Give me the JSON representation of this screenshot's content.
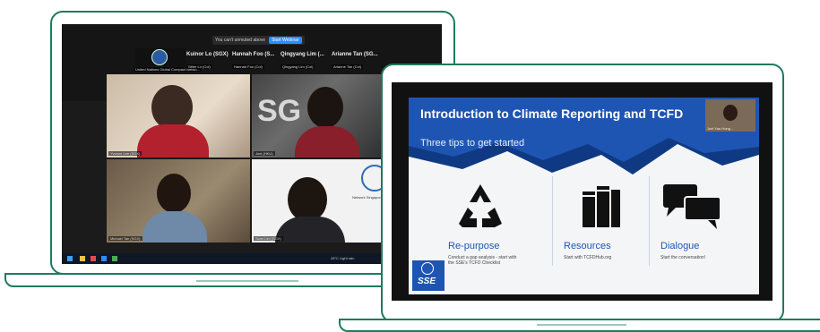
{
  "left_laptop": {
    "zoom_banner": {
      "text": "You can't unmuted above",
      "button": "Start Webinar"
    },
    "top_participants": [
      {
        "name": "Kuinor Lo (SGX)",
        "sub": "Sitter Lo (Col)"
      },
      {
        "name": "Hannah Foo (S...",
        "sub": "Hannah Foo (Col)"
      },
      {
        "name": "Qingyang Lim (...",
        "sub": "Qingyang Lim (Col)"
      },
      {
        "name": "Arianne Tan (SG...",
        "sub": "Arianne Tan (Col)"
      }
    ],
    "first_tile_caption": "United Nations Global Compact Netwo...",
    "video_tiles": [
      {
        "name": "Yvonne Lee (SGX)"
      },
      {
        "name": "Joel (HKU)"
      },
      {
        "name": "Michael Tan (SGX)"
      },
      {
        "name": "Sumi Lim (SGX)"
      }
    ],
    "logo_caption": "Network Singapore",
    "taskbar": {
      "temp": "28°C",
      "weather": "Light rain"
    }
  },
  "right_laptop": {
    "slide": {
      "title": "Introduction to Climate Reporting and TCFD",
      "subtitle": "Three tips to get started",
      "tips": [
        {
          "icon": "recycle-icon",
          "heading": "Re-purpose",
          "text": "Conduct a gap analysis - start with the SSE's TCFD Checklist"
        },
        {
          "icon": "books-icon",
          "heading": "Resources",
          "text": "Start with TCFDHub.org"
        },
        {
          "icon": "speech-bubbles-icon",
          "heading": "Dialogue",
          "text": "Start the conversation!"
        }
      ],
      "logo_text": "SSE",
      "presenter_caption": "Joel Yau Hong..."
    }
  },
  "colors": {
    "accent": "#1f7a5e",
    "slide_blue": "#1e55b3",
    "slide_dark": "#0f3a83"
  }
}
